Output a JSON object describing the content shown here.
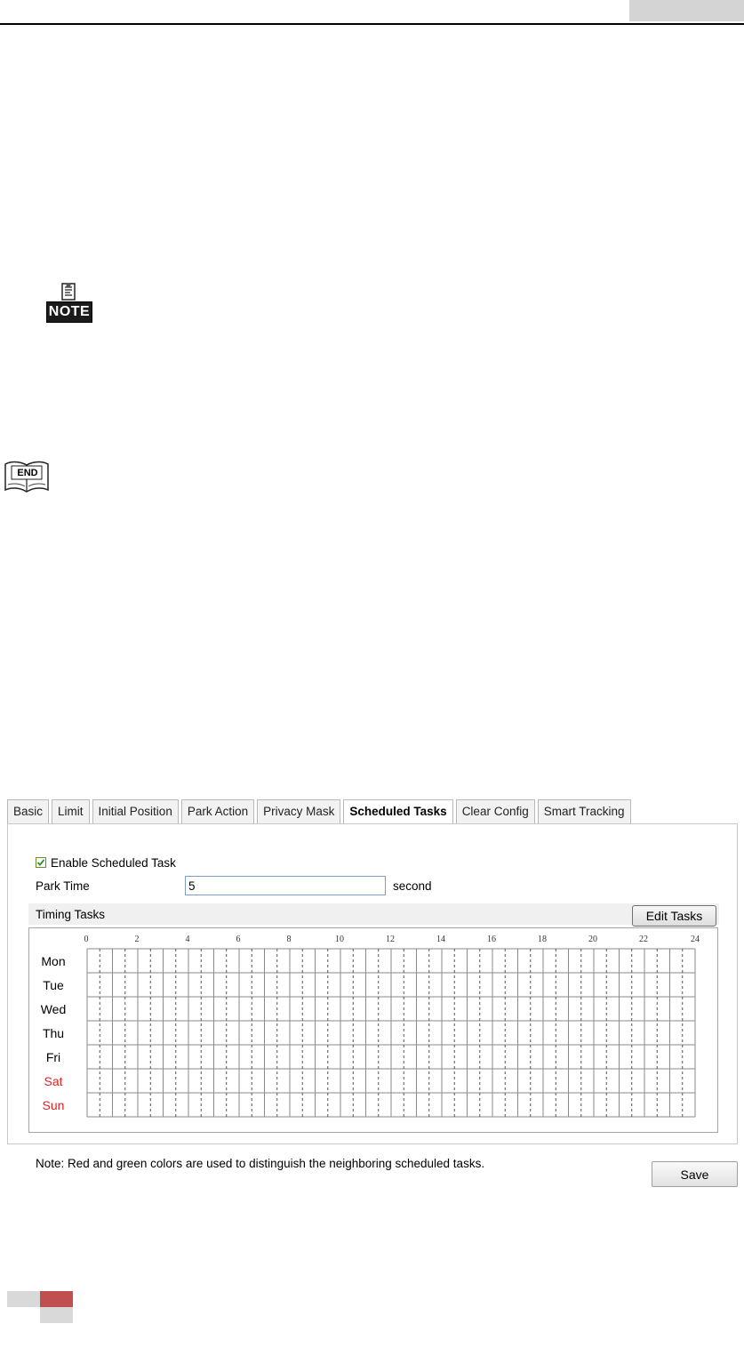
{
  "tabs": [
    "Basic",
    "Limit",
    "Initial Position",
    "Park Action",
    "Privacy Mask",
    "Scheduled Tasks",
    "Clear Config",
    "Smart Tracking"
  ],
  "active_tab": "Scheduled Tasks",
  "enable_scheduled_task": {
    "label": "Enable Scheduled Task",
    "checked": true
  },
  "park_time": {
    "label": "Park Time",
    "value": "5",
    "unit": "second"
  },
  "timing_tasks": {
    "label": "Timing Tasks",
    "edit_button": "Edit Tasks",
    "hours": [
      "0",
      "2",
      "4",
      "6",
      "8",
      "10",
      "12",
      "14",
      "16",
      "18",
      "20",
      "22",
      "24"
    ],
    "days": [
      "Mon",
      "Tue",
      "Wed",
      "Thu",
      "Fri",
      "Sat",
      "Sun"
    ],
    "weekend_color": "#e02020"
  },
  "note": "Note: Red and green colors are used to distinguish the neighboring scheduled tasks.",
  "save_button": "Save",
  "icons": {
    "note": "NOTE",
    "end": "END"
  },
  "footer_accent": "#c0504d"
}
